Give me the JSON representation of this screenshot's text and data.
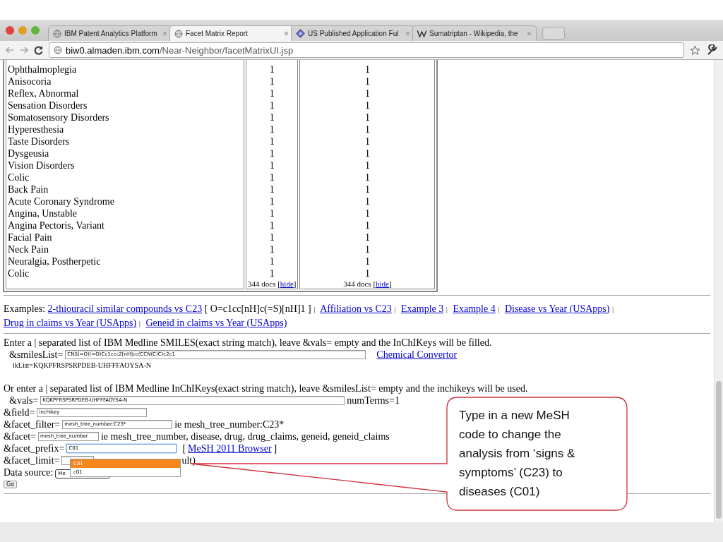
{
  "browser": {
    "tabs": [
      {
        "title": "IBM Patent Analytics Platform",
        "kind": "globe",
        "selected": false
      },
      {
        "title": "Facet Matrix Report",
        "kind": "globe",
        "selected": true
      },
      {
        "title": "US Published Application Ful",
        "kind": "diamond",
        "selected": false
      },
      {
        "title": "Sumatriptan - Wikipedia, the",
        "kind": "w",
        "selected": false
      }
    ],
    "address": {
      "host": "biw0.almaden.ibm.com",
      "path": "/Near-Neighbor/facetMatrixUI.jsp"
    }
  },
  "table": {
    "rows": [
      {
        "term": "Ophthalmoplegia",
        "count_1": "1",
        "count_2": "1"
      },
      {
        "term": "Anisocoria",
        "count_1": "1",
        "count_2": "1"
      },
      {
        "term": "Reflex, Abnormal",
        "count_1": "1",
        "count_2": "1"
      },
      {
        "term": "Sensation Disorders",
        "count_1": "1",
        "count_2": "1"
      },
      {
        "term": "Somatosensory Disorders",
        "count_1": "1",
        "count_2": "1"
      },
      {
        "term": "Hyperesthesia",
        "count_1": "1",
        "count_2": "1"
      },
      {
        "term": "Taste Disorders",
        "count_1": "1",
        "count_2": "1"
      },
      {
        "term": "Dysgeusia",
        "count_1": "1",
        "count_2": "1"
      },
      {
        "term": "Vision Disorders",
        "count_1": "1",
        "count_2": "1"
      },
      {
        "term": "Colic",
        "count_1": "1",
        "count_2": "1"
      },
      {
        "term": "Back Pain",
        "count_1": "1",
        "count_2": "1"
      },
      {
        "term": "Acute Coronary Syndrome",
        "count_1": "1",
        "count_2": "1"
      },
      {
        "term": "Angina, Unstable",
        "count_1": "1",
        "count_2": "1"
      },
      {
        "term": "Angina Pectoris, Variant",
        "count_1": "1",
        "count_2": "1"
      },
      {
        "term": "Facial Pain",
        "count_1": "1",
        "count_2": "1"
      },
      {
        "term": "Neck Pain",
        "count_1": "1",
        "count_2": "1"
      },
      {
        "term": "Neuralgia, Postherpetic",
        "count_1": "1",
        "count_2": "1"
      },
      {
        "term": "Colic",
        "count_1": "1",
        "count_2": "1"
      }
    ],
    "footer": [
      {
        "prefix": "344 docs [",
        "link": "hide",
        "suffix": "]"
      },
      {
        "prefix": "344 docs [",
        "link": "hide",
        "suffix": "]"
      }
    ]
  },
  "examples": [
    {
      "kind": "text",
      "text": "Examples:"
    },
    {
      "kind": "link",
      "text": "2-thiouracil similar compounds vs C23"
    },
    {
      "kind": "text",
      "text": "[ O=c1cc[nH]c(=S)[nH]1 ]"
    },
    {
      "kind": "sep",
      "text": "|"
    },
    {
      "kind": "link",
      "text": "Affiliation vs C23"
    },
    {
      "kind": "sep",
      "text": "|"
    },
    {
      "kind": "link",
      "text": "Example 3"
    },
    {
      "kind": "sep",
      "text": "|"
    },
    {
      "kind": "link",
      "text": "Example 4"
    },
    {
      "kind": "sep",
      "text": "|"
    },
    {
      "kind": "link",
      "text": "Disease vs Year (USApps)"
    },
    {
      "kind": "sep",
      "text": "|"
    },
    {
      "kind": "link",
      "text": "Drug in claims vs Year (USApps)"
    },
    {
      "kind": "sep",
      "text": "|"
    },
    {
      "kind": "link",
      "text": "Geneid in claims vs Year (USApps)"
    }
  ],
  "form": {
    "smiles_intro": "Enter a | separated list of IBM Medline SMILES(exact string match), leave &vals= empty and the InChIKeys will be filled.",
    "smiles_list": {
      "label": "&smilesList=",
      "value": "CNS(=O)(=O)Cc1ccc2[nH]cc(CCN(C)C)c2c1",
      "link": "Chemical Convertor"
    },
    "ik_list": "ikList=KQKPFRSPSRPDEB-UHFFFAOYSA-N",
    "inchi_intro": "Or enter a | separated list of IBM Medline InChIKeys(exact string match), leave &smilesList= empty and the inchikeys will be used.",
    "vals": {
      "label": "&vals=",
      "value": "KQKPFRSPSRPDEB-UHFFFAOYSA-N",
      "after": "numTerms=1"
    },
    "field": {
      "label": "&field=",
      "value": "inchikey"
    },
    "facet_filter": {
      "label": "&facet_filter=",
      "value": "mesh_tree_number:C23*",
      "after": "ie mesh_tree_number:C23*"
    },
    "facet": {
      "label": "&facet=",
      "value": "mesh_tree_number",
      "after": "ie mesh_tree_number, disease, drug, drug_claims, geneid, geneid_claims"
    },
    "facet_prefix": {
      "label": "&facet_prefix=",
      "value": "C01",
      "focused": true,
      "before_link": "[",
      "link": "MeSH 2011 Browser",
      "after_link": "]"
    },
    "facet_limit": {
      "label": "&facet_limit=",
      "after": "ult)"
    },
    "data_source": {
      "label": "Data source:",
      "value": "Me"
    },
    "go": "Go",
    "autocomplete": [
      {
        "text": "C01",
        "selected": true
      },
      {
        "text": "c01",
        "selected": false
      }
    ]
  },
  "callout": {
    "text": "Type in a new MeSH code to change the analysis from ‘signs & symptoms’ (C23) to diseases (C01)"
  }
}
